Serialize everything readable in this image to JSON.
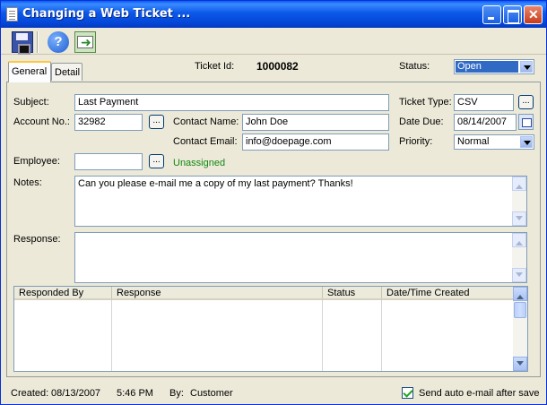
{
  "window": {
    "title": "Changing a Web Ticket ..."
  },
  "tabs": [
    {
      "label": "General",
      "active": true
    },
    {
      "label": "Detail",
      "active": false
    }
  ],
  "header": {
    "ticket_id_label": "Ticket Id:",
    "ticket_id_value": "1000082",
    "status_label": "Status:",
    "status_value": "Open"
  },
  "form": {
    "subject_label": "Subject:",
    "subject_value": "Last Payment",
    "ticket_type_label": "Ticket Type:",
    "ticket_type_value": "CSV",
    "account_label": "Account No.:",
    "account_value": "32982",
    "contact_name_label": "Contact Name:",
    "contact_name_value": "John Doe",
    "date_due_label": "Date Due:",
    "date_due_value": "08/14/2007",
    "contact_email_label": "Contact Email:",
    "contact_email_value": "info@doepage.com",
    "priority_label": "Priority:",
    "priority_value": "Normal",
    "employee_label": "Employee:",
    "employee_value": "",
    "employee_status": "Unassigned",
    "notes_label": "Notes:",
    "notes_value": "Can you please e-mail me a copy of my last payment?  Thanks!",
    "response_label": "Response:",
    "response_value": "",
    "ellipsis": "..."
  },
  "responses_table": {
    "columns": [
      "Responded By",
      "Response",
      "Status",
      "Date/Time Created"
    ],
    "rows": []
  },
  "footer": {
    "created_label": "Created:",
    "created_date": "08/13/2007",
    "created_time": "5:46 PM",
    "by_label": "By:",
    "by_value": "Customer",
    "auto_email_label": "Send auto e-mail after save",
    "auto_email_checked": true
  },
  "colors": {
    "accent": "#316ac5",
    "unassigned": "#118811",
    "titlebar": "#0c58e8"
  }
}
